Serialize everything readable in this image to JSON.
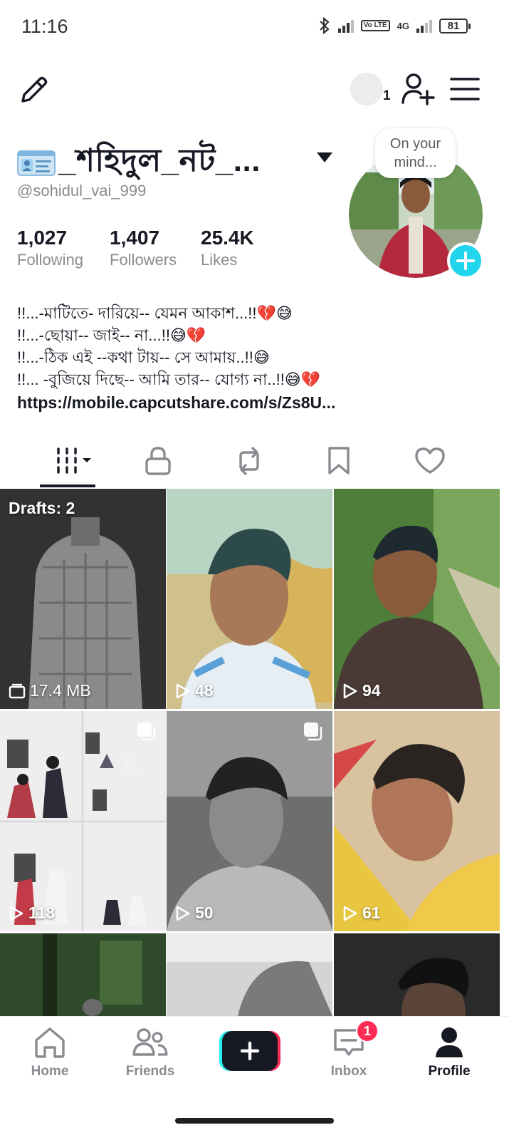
{
  "status_bar": {
    "time": "11:16",
    "network_label": "4G",
    "volte_label": "Vo LTE",
    "battery": "81"
  },
  "header": {
    "story_count": "1"
  },
  "profile": {
    "display_name": "_শহিদুল_নট_...",
    "username": "@sohidul_vai_999",
    "stats": [
      {
        "value": "1,027",
        "label": "Following"
      },
      {
        "value": "1,407",
        "label": "Followers"
      },
      {
        "value": "25.4K",
        "label": "Likes"
      }
    ],
    "bio_lines": [
      "!!...-মাটিতে- দারিয়ে-- যেমন আকাশ...!!💔😅",
      "!!...-ছোয়া-- জাই-- না...!!😅💔",
      "!!...-ঠিক এই --কথা টায়-- সে আমায়..!!😅",
      "!!... -বুজিয়ে দিছে-- আমি তার-- যোগ্য না..!!😅💔"
    ],
    "link": "https://mobile.capcutshare.com/s/Zs8U...",
    "thought_bubble": "On your mind..."
  },
  "tabs": {
    "active": "videos",
    "items": [
      "videos",
      "private",
      "reposts",
      "favorites",
      "liked"
    ]
  },
  "grid": {
    "drafts_label": "Drafts: 2",
    "drafts_size": "17.4 MB",
    "views": [
      "48",
      "94",
      "118",
      "50",
      "61"
    ]
  },
  "bottom_nav": {
    "home": "Home",
    "friends": "Friends",
    "inbox": "Inbox",
    "profile": "Profile",
    "inbox_badge": "1"
  },
  "colors": {
    "accent_cyan": "#20d5ec",
    "accent_red": "#fe2c55",
    "text_primary": "#161823",
    "text_secondary": "#8a8b91"
  }
}
